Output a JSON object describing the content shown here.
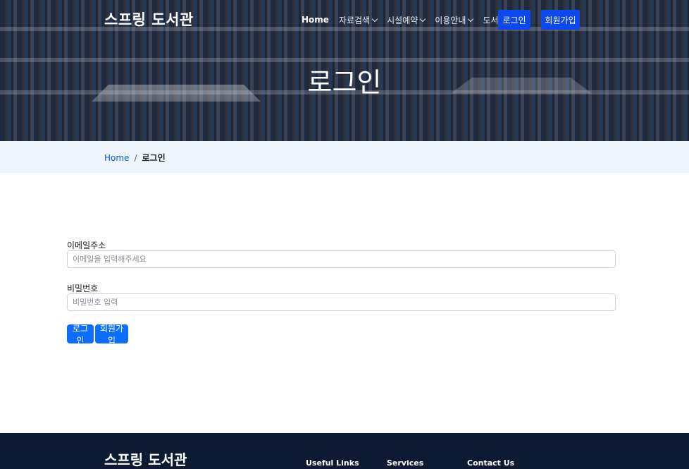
{
  "header": {
    "brand": "스프링 도서관",
    "nav": [
      {
        "label": "Home",
        "dropdown": false,
        "active": true
      },
      {
        "label": "자료검색",
        "dropdown": true
      },
      {
        "label": "시설예약",
        "dropdown": true
      },
      {
        "label": "이용안내",
        "dropdown": true
      },
      {
        "label": "도서관소식",
        "dropdown": true
      }
    ],
    "login_button": "로그인",
    "signup_button": "회원가입"
  },
  "hero": {
    "title": "로그인"
  },
  "breadcrumb": {
    "home": "Home",
    "separator": "/",
    "current": "로그인"
  },
  "form": {
    "email_label": "이메일주소",
    "email_placeholder": "이메일을 입력해주세요",
    "email_value": "",
    "password_label": "비밀번호",
    "password_placeholder": "비밀번호 입력",
    "password_value": "",
    "login_button": "로그인",
    "signup_button": "회원가입"
  },
  "footer": {
    "brand": "스프링 도서관",
    "headings": [
      "Useful Links",
      "Services",
      "Contact Us"
    ]
  },
  "colors": {
    "accent": "#0d6efd",
    "nav_button": "#0d47f0",
    "footer_bg": "#0c1a33",
    "breadcrumb_bg": "#eef4fc"
  }
}
